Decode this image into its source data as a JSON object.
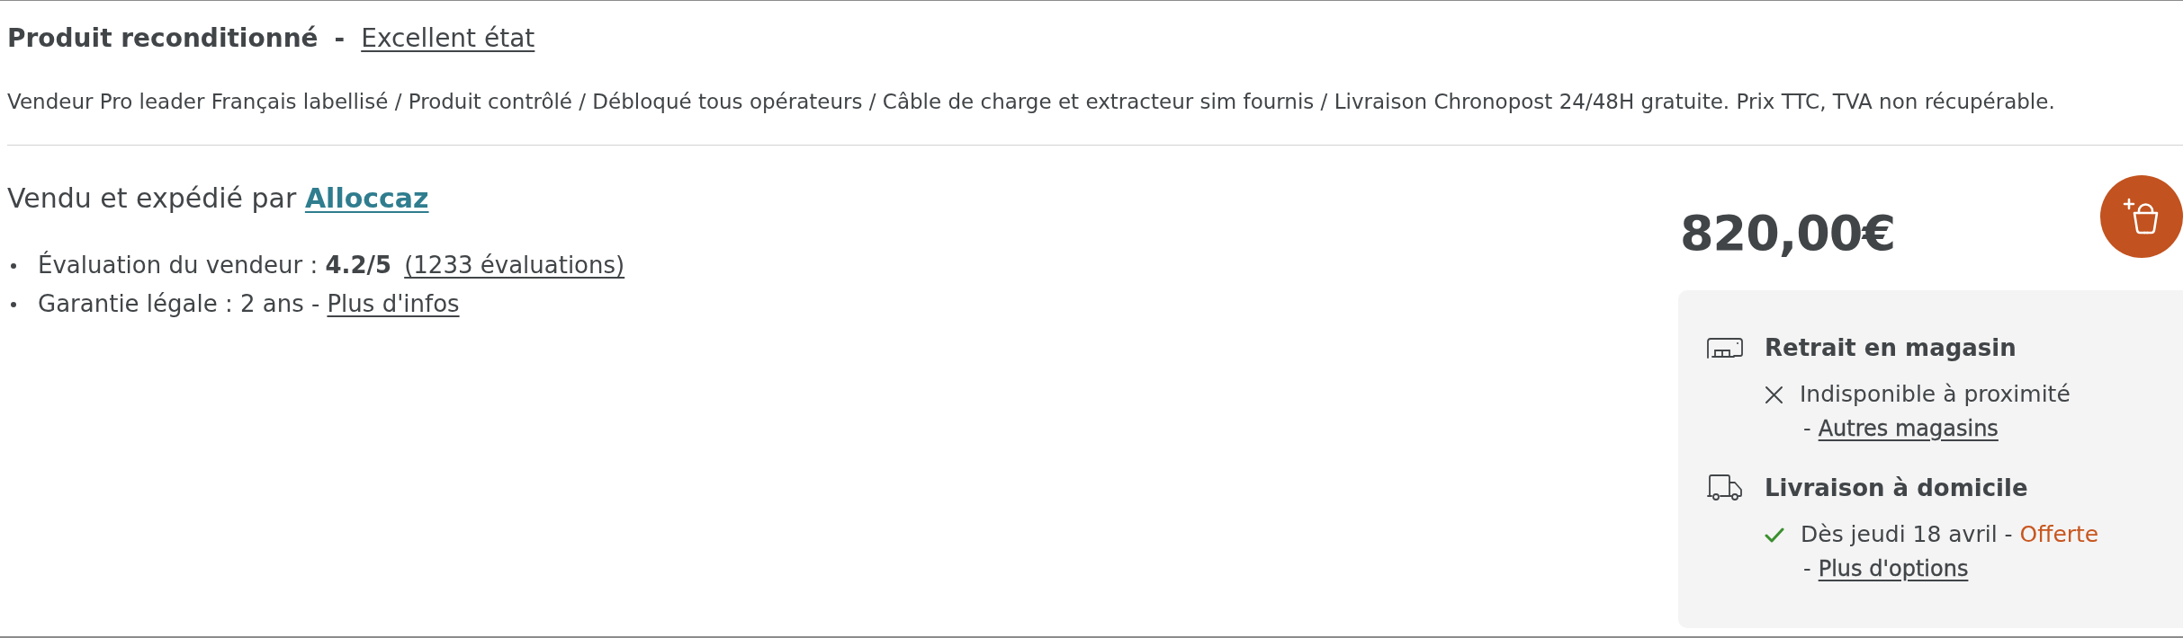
{
  "heading": {
    "title": "Produit reconditionné",
    "separator": "-",
    "condition_link": "Excellent état"
  },
  "description": "Vendeur Pro leader Français labellisé / Produit contrôlé / Débloqué tous opérateurs / Câble de charge et extracteur sim fournis / Livraison Chronopost 24/48H gratuite. Prix TTC, TVA non récupérable.",
  "seller": {
    "prefix": "Vendu et expédié par",
    "name": "Alloccaz"
  },
  "seller_details": [
    {
      "text": "Évaluation du vendeur : **4.2/5**",
      "link": "(1233 évaluations)"
    },
    {
      "text": "Garantie légale : 2 ans -",
      "link": "Plus d'infos"
    }
  ],
  "offer": {
    "price": "820,00€",
    "availability": [
      {
        "kind": "store",
        "title": "Retrait en magasin",
        "available": false,
        "status": "Indisponible à proximité",
        "link_prefix": "-",
        "link": "Autres magasins"
      },
      {
        "kind": "delivery",
        "title": "Livraison à domicile",
        "available": true,
        "status": "Dès jeudi 18 avril -",
        "note": "Offerte",
        "link_prefix": "-",
        "link": "Plus d'options"
      }
    ]
  }
}
